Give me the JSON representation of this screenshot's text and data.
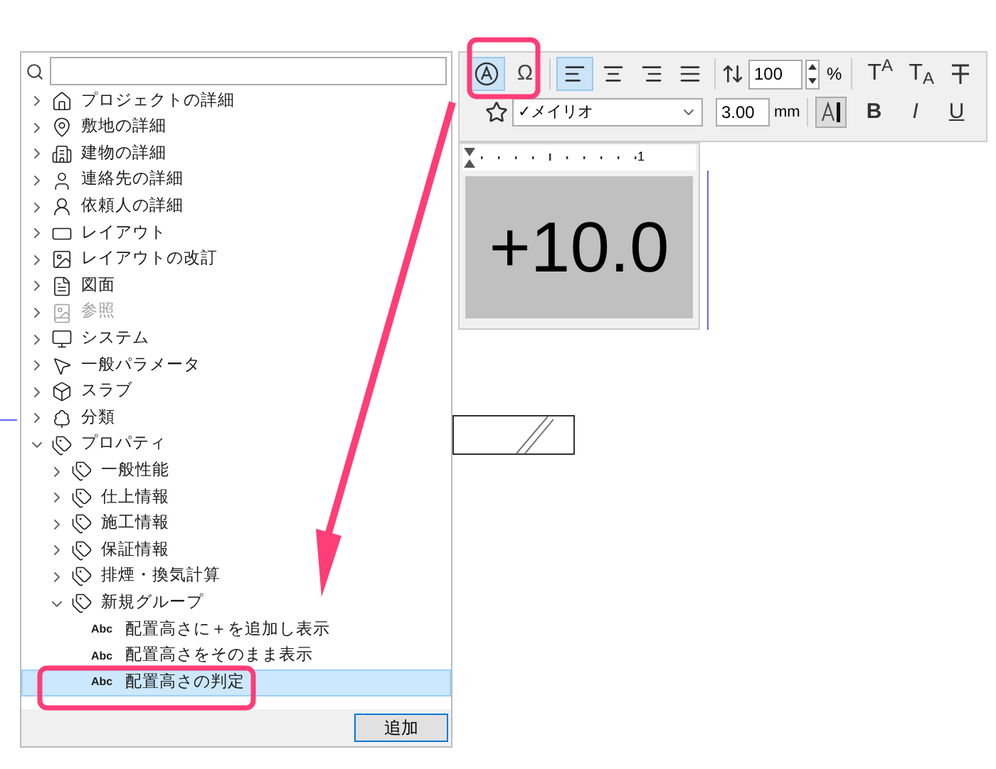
{
  "tree": [
    {
      "label": "プロジェクトの詳細",
      "kind": "group",
      "expanded": false,
      "disabled": false,
      "selected": false
    },
    {
      "label": "敷地の詳細",
      "kind": "group",
      "expanded": false,
      "disabled": false,
      "selected": false
    },
    {
      "label": "建物の詳細",
      "kind": "group",
      "expanded": false,
      "disabled": false,
      "selected": false
    },
    {
      "label": "連絡先の詳細",
      "kind": "group",
      "expanded": false,
      "disabled": false,
      "selected": false
    },
    {
      "label": "依頼人の詳細",
      "kind": "group",
      "expanded": false,
      "disabled": false,
      "selected": false
    },
    {
      "label": "レイアウト",
      "kind": "group",
      "expanded": false,
      "disabled": false,
      "selected": false
    },
    {
      "label": "レイアウトの改訂",
      "kind": "group",
      "expanded": false,
      "disabled": false,
      "selected": false
    },
    {
      "label": "図面",
      "kind": "group",
      "expanded": false,
      "disabled": false,
      "selected": false
    },
    {
      "label": "参照",
      "kind": "group",
      "expanded": false,
      "disabled": true,
      "selected": false
    },
    {
      "label": "システム",
      "kind": "group",
      "expanded": false,
      "disabled": false,
      "selected": false
    },
    {
      "label": "一般パラメータ",
      "kind": "group",
      "expanded": false,
      "disabled": false,
      "selected": false
    },
    {
      "label": "スラブ",
      "kind": "group",
      "expanded": false,
      "disabled": false,
      "selected": false
    },
    {
      "label": "分類",
      "kind": "group",
      "expanded": false,
      "disabled": false,
      "selected": false
    },
    {
      "label": "プロパティ",
      "kind": "group",
      "expanded": true,
      "disabled": false,
      "selected": false,
      "children": [
        {
          "label": "一般性能",
          "kind": "group",
          "expanded": false,
          "disabled": false,
          "selected": false
        },
        {
          "label": "仕上情報",
          "kind": "group",
          "expanded": false,
          "disabled": false,
          "selected": false
        },
        {
          "label": "施工情報",
          "kind": "group",
          "expanded": false,
          "disabled": false,
          "selected": false
        },
        {
          "label": "保証情報",
          "kind": "group",
          "expanded": false,
          "disabled": false,
          "selected": false
        },
        {
          "label": "排煙・換気計算",
          "kind": "group",
          "expanded": false,
          "disabled": false,
          "selected": false
        },
        {
          "label": "新規グループ",
          "kind": "group",
          "expanded": true,
          "disabled": false,
          "selected": false,
          "children": [
            {
              "label": "配置高さに＋を追加し表示",
              "kind": "field",
              "tag": "Abc",
              "disabled": false,
              "selected": false
            },
            {
              "label": "配置高さをそのまま表示",
              "kind": "field",
              "tag": "Abc",
              "disabled": false,
              "selected": false
            },
            {
              "label": "配置高さの判定",
              "kind": "field",
              "tag": "Abc",
              "disabled": false,
              "selected": true
            }
          ]
        }
      ]
    }
  ],
  "add_button": "追加",
  "toolbar": {
    "row1": [
      {
        "kind": "autotext",
        "selected": true
      },
      {
        "kind": "symbol",
        "label": "Ω",
        "selected": false
      },
      {
        "kind": "align-left",
        "selected": true
      },
      {
        "kind": "align-center",
        "selected": false
      },
      {
        "kind": "align-right",
        "selected": false
      },
      {
        "kind": "justify",
        "selected": false
      }
    ],
    "line_spacing": "100",
    "percent": "%",
    "styles1": [
      "T$^{A}$",
      "T$_{A}$"
    ],
    "font": "✓メイリオ",
    "size": "3.00",
    "unit": "mm",
    "color_selected": true,
    "styles2": [
      {
        "label": "B",
        "kind": "bold"
      },
      {
        "label": "I",
        "kind": "italic"
      },
      {
        "label": "U",
        "kind": "underline"
      }
    ]
  },
  "preview": {
    "ruler": "1",
    "text": "+10.0"
  }
}
